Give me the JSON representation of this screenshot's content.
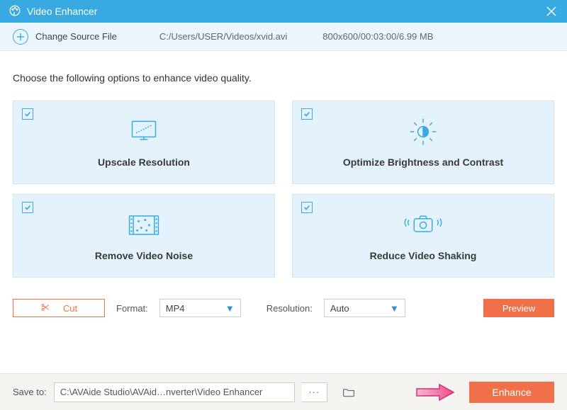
{
  "titlebar": {
    "title": "Video Enhancer"
  },
  "source": {
    "change_label": "Change Source File",
    "path": "C:/Users/USER/Videos/xvid.avi",
    "meta": "800x600/00:03:00/6.99 MB"
  },
  "instruction": "Choose the following options to enhance video quality.",
  "tiles": {
    "upscale": "Upscale Resolution",
    "brightness": "Optimize Brightness and Contrast",
    "noise": "Remove Video Noise",
    "shake": "Reduce Video Shaking"
  },
  "controls": {
    "cut": "Cut",
    "format_label": "Format:",
    "format_value": "MP4",
    "resolution_label": "Resolution:",
    "resolution_value": "Auto",
    "preview": "Preview"
  },
  "footer": {
    "save_label": "Save to:",
    "save_path": "C:\\AVAide Studio\\AVAid…nverter\\Video Enhancer",
    "dots": "···",
    "enhance": "Enhance"
  }
}
